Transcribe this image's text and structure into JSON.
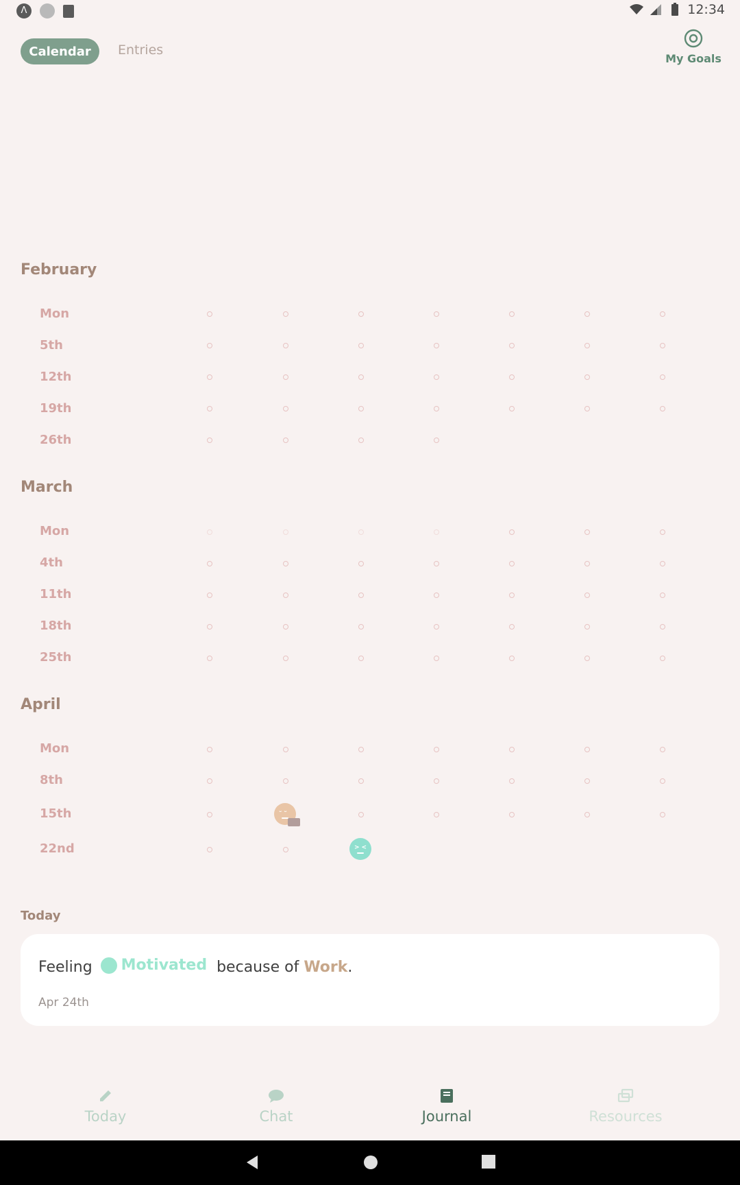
{
  "status_bar": {
    "time": "12:34"
  },
  "tabs": {
    "calendar": "Calendar",
    "entries": "Entries"
  },
  "goals": {
    "label": "My Goals"
  },
  "months": [
    {
      "name": "February",
      "rows": [
        "Mon",
        "5th",
        "12th",
        "19th",
        "26th"
      ]
    },
    {
      "name": "March",
      "rows": [
        "Mon",
        "4th",
        "11th",
        "18th",
        "25th"
      ]
    },
    {
      "name": "April",
      "rows": [
        "Mon",
        "8th",
        "15th",
        "22nd"
      ]
    }
  ],
  "today": {
    "section_label": "Today",
    "prefix": "Feeling",
    "mood": "Motivated",
    "connector": "because of",
    "cause": "Work",
    "suffix": ".",
    "date": "Apr 24th"
  },
  "bottom_nav": [
    {
      "label": "Today",
      "icon": "pencil-icon"
    },
    {
      "label": "Chat",
      "icon": "chat-bubble-icon"
    },
    {
      "label": "Journal",
      "icon": "journal-book-icon",
      "active": true
    },
    {
      "label": "Resources",
      "icon": "resources-icon"
    }
  ],
  "colors": {
    "background": "#f8f2f1",
    "accent_green": "#7f9f8d",
    "mood_teal": "#9ce6cf",
    "cause_tan": "#c7a78a"
  }
}
